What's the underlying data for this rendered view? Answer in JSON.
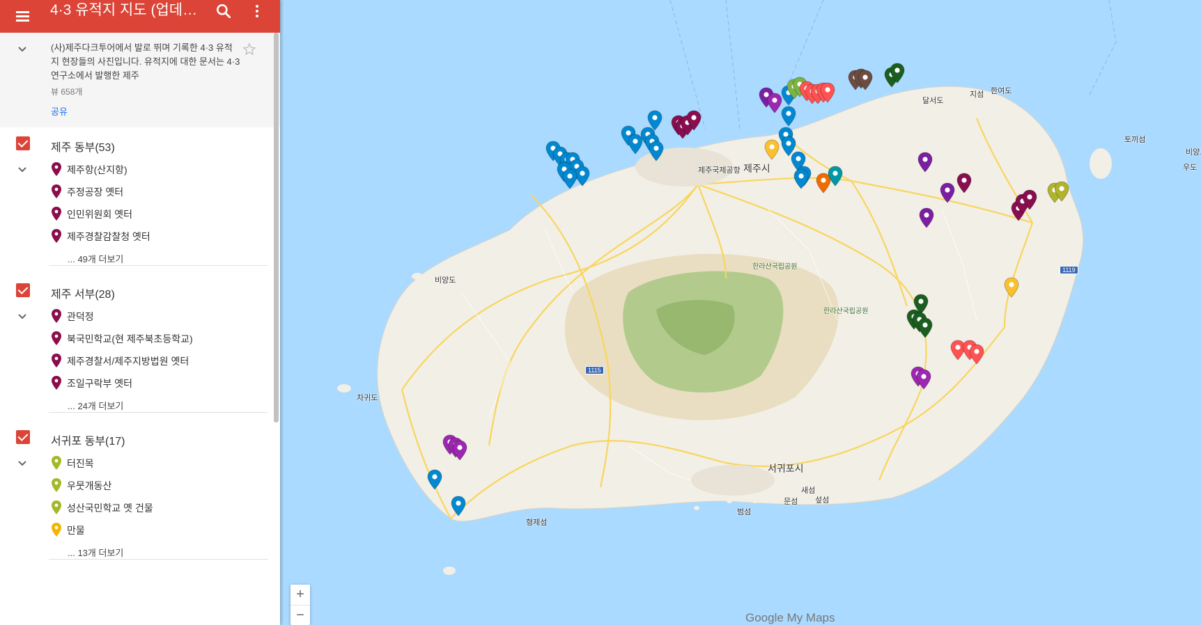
{
  "header": {
    "title": "4·3 유적지 지도 (업데이…",
    "menu_icon": "hamburger-menu-icon",
    "search_icon": "search-icon",
    "more_icon": "more-vert-icon"
  },
  "description": {
    "text": "(사)제주다크투어에서 발로 뛰며 기록한 4·3 유적지 현장들의 사진입니다. 유적지에 대한 문서는 4·3 연구소에서 발행한 제주",
    "views": "뷰 658개",
    "share": "공유"
  },
  "layers": [
    {
      "title": "제주 동부(53)",
      "checked": true,
      "items": [
        {
          "label": "제주항(산지항)",
          "color": "#8b0e4b"
        },
        {
          "label": "주정공장 옛터",
          "color": "#8b0e4b"
        },
        {
          "label": "인민위원회 옛터",
          "color": "#8b0e4b"
        },
        {
          "label": "제주경찰감찰청 옛터",
          "color": "#8b0e4b"
        }
      ],
      "more": "... 49개 더보기"
    },
    {
      "title": "제주 서부(28)",
      "checked": true,
      "items": [
        {
          "label": "관덕정",
          "color": "#8b0e4b"
        },
        {
          "label": "북국민학교(현 제주북초등학교)",
          "color": "#8b0e4b"
        },
        {
          "label": "제주경찰서/제주지방법원 옛터",
          "color": "#8b0e4b"
        },
        {
          "label": "조일구락부 옛터",
          "color": "#8b0e4b"
        }
      ],
      "more": "... 24개 더보기"
    },
    {
      "title": "서귀포 동부(17)",
      "checked": true,
      "items": [
        {
          "label": "터진목",
          "color": "#a5b829"
        },
        {
          "label": "우뭇개동산",
          "color": "#a5b829"
        },
        {
          "label": "성산국민학교 옛 건물",
          "color": "#a5b829"
        },
        {
          "label": "만물",
          "color": "#f4b400"
        }
      ],
      "more": "... 13개 더보기"
    }
  ],
  "map": {
    "places": [
      "제주국제공항",
      "제주시",
      "한라산국립공원",
      "한라산국립공원",
      "비양도",
      "차귀도",
      "형제섬",
      "서귀포시",
      "새섬",
      "문섬",
      "섶섬",
      "범섬",
      "토끼섬",
      "비양도",
      "우도",
      "한여도",
      "달서도",
      "지섬"
    ],
    "road_shields": [
      "1115",
      "1119"
    ],
    "zoom_in": "+",
    "zoom_out": "−",
    "logo": "Google My Maps"
  },
  "colors": {
    "header": "#db4437",
    "checkbox": "#db4437",
    "water": "#aadaff",
    "land": "#f2efe6"
  }
}
